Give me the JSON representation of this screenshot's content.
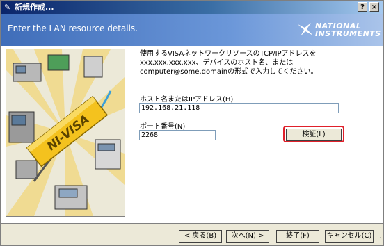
{
  "window": {
    "title": "新規作成...",
    "help": "?",
    "close": "×"
  },
  "banner": {
    "heading": "Enter the LAN resource details.",
    "logo_line1": "NATIONAL",
    "logo_line2": "INSTRUMENTS"
  },
  "illustration": {
    "badge": "NI-VISA"
  },
  "form": {
    "instruction": "使用するVISAネットワークリソースのTCP/IPアドレスをxxx.xxx.xxx.xxx、デバイスのホスト名、またはcomputer@some.domainの形式で入力してください。",
    "host_label": "ホスト名またはIPアドレス(H)",
    "host_value": "192.168.21.118",
    "port_label": "ポート番号(N)",
    "port_value": "2268",
    "verify_label": "検証(L)"
  },
  "footer": {
    "back_label": "< 戻る(B)",
    "next_label": "次へ(N) >",
    "finish_label": "終了(F)",
    "cancel_label": "キャンセル(C)"
  },
  "colors": {
    "highlight": "#e0202a",
    "banner": "#3f6db9",
    "titlebar": "#0a246a"
  }
}
